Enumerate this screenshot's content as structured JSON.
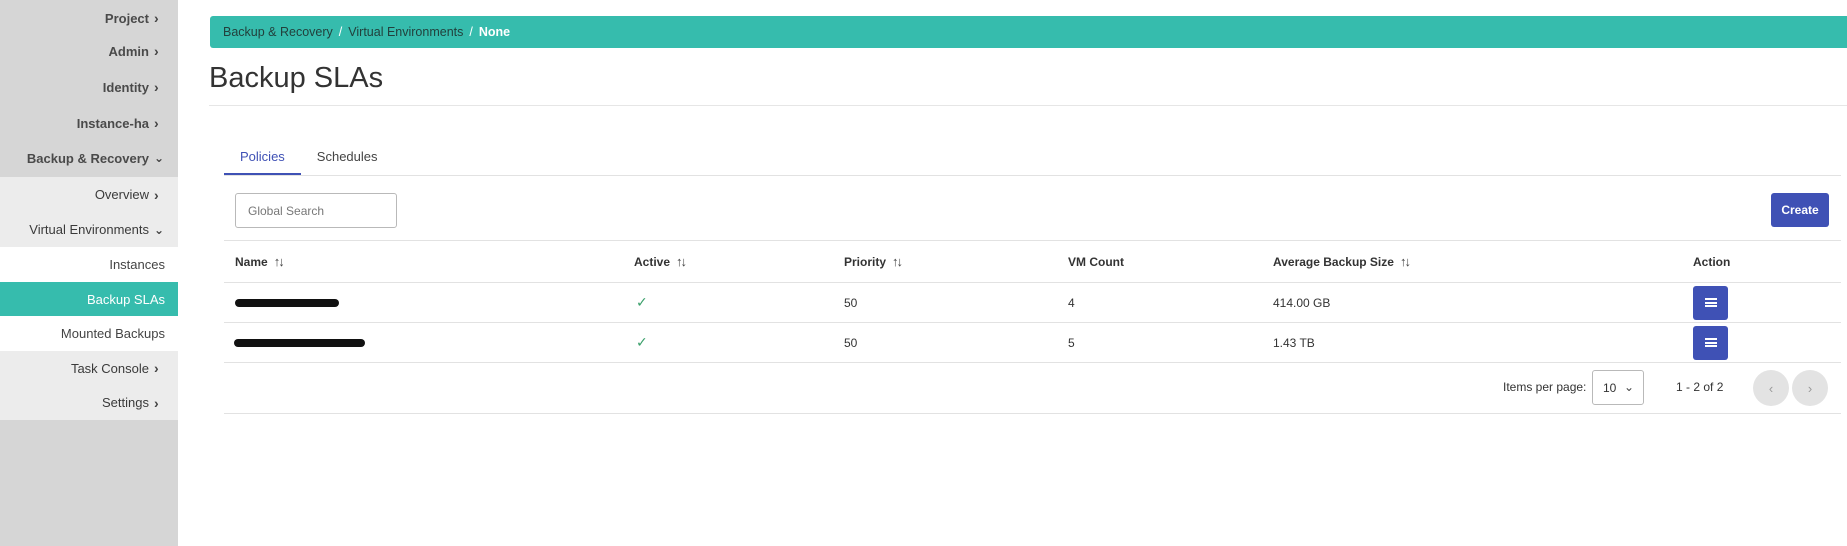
{
  "sidebar": {
    "items": [
      {
        "label": "Project",
        "chevron": "right"
      },
      {
        "label": "Admin",
        "chevron": "right"
      },
      {
        "label": "Identity",
        "chevron": "right"
      },
      {
        "label": "Instance-ha",
        "chevron": "right"
      },
      {
        "label": "Backup & Recovery",
        "chevron": "down"
      },
      {
        "label": "Overview",
        "chevron": "right"
      },
      {
        "label": "Virtual Environments",
        "chevron": "down"
      },
      {
        "label": "Instances"
      },
      {
        "label": "Backup SLAs"
      },
      {
        "label": "Mounted Backups"
      },
      {
        "label": "Task Console",
        "chevron": "right"
      },
      {
        "label": "Settings",
        "chevron": "right"
      }
    ],
    "active": "Backup SLAs"
  },
  "breadcrumb": {
    "items": [
      "Backup & Recovery",
      "Virtual Environments",
      "None"
    ],
    "separator": "/"
  },
  "page": {
    "title": "Backup SLAs"
  },
  "tabs": [
    {
      "label": "Policies",
      "active": true
    },
    {
      "label": "Schedules",
      "active": false
    }
  ],
  "search": {
    "placeholder": "Global Search",
    "value": ""
  },
  "create_button": {
    "label": "Create"
  },
  "table": {
    "columns": [
      "Name",
      "Active",
      "Priority",
      "VM Count",
      "Average Backup Size",
      "Action"
    ],
    "rows": [
      {
        "name": "[redacted]",
        "active": true,
        "priority": "50",
        "vm_count": "4",
        "avg_backup_size": "414.00 GB"
      },
      {
        "name": "[redacted]",
        "active": true,
        "priority": "50",
        "vm_count": "5",
        "avg_backup_size": "1.43 TB"
      }
    ]
  },
  "pagination": {
    "items_per_page_label": "Items per page:",
    "items_per_page": "10",
    "range": "1 - 2 of 2"
  },
  "colors": {
    "accent": "#36bcad",
    "primary": "#3f51b5",
    "sidebar_bg": "#d6d6d6"
  },
  "icons": {
    "chevron_right": "chevron-right-icon",
    "chevron_down": "chevron-down-icon",
    "sort": "sort-icon",
    "check": "check-icon",
    "menu": "menu-icon",
    "prev": "chevron-left-icon",
    "next": "chevron-right-icon"
  }
}
